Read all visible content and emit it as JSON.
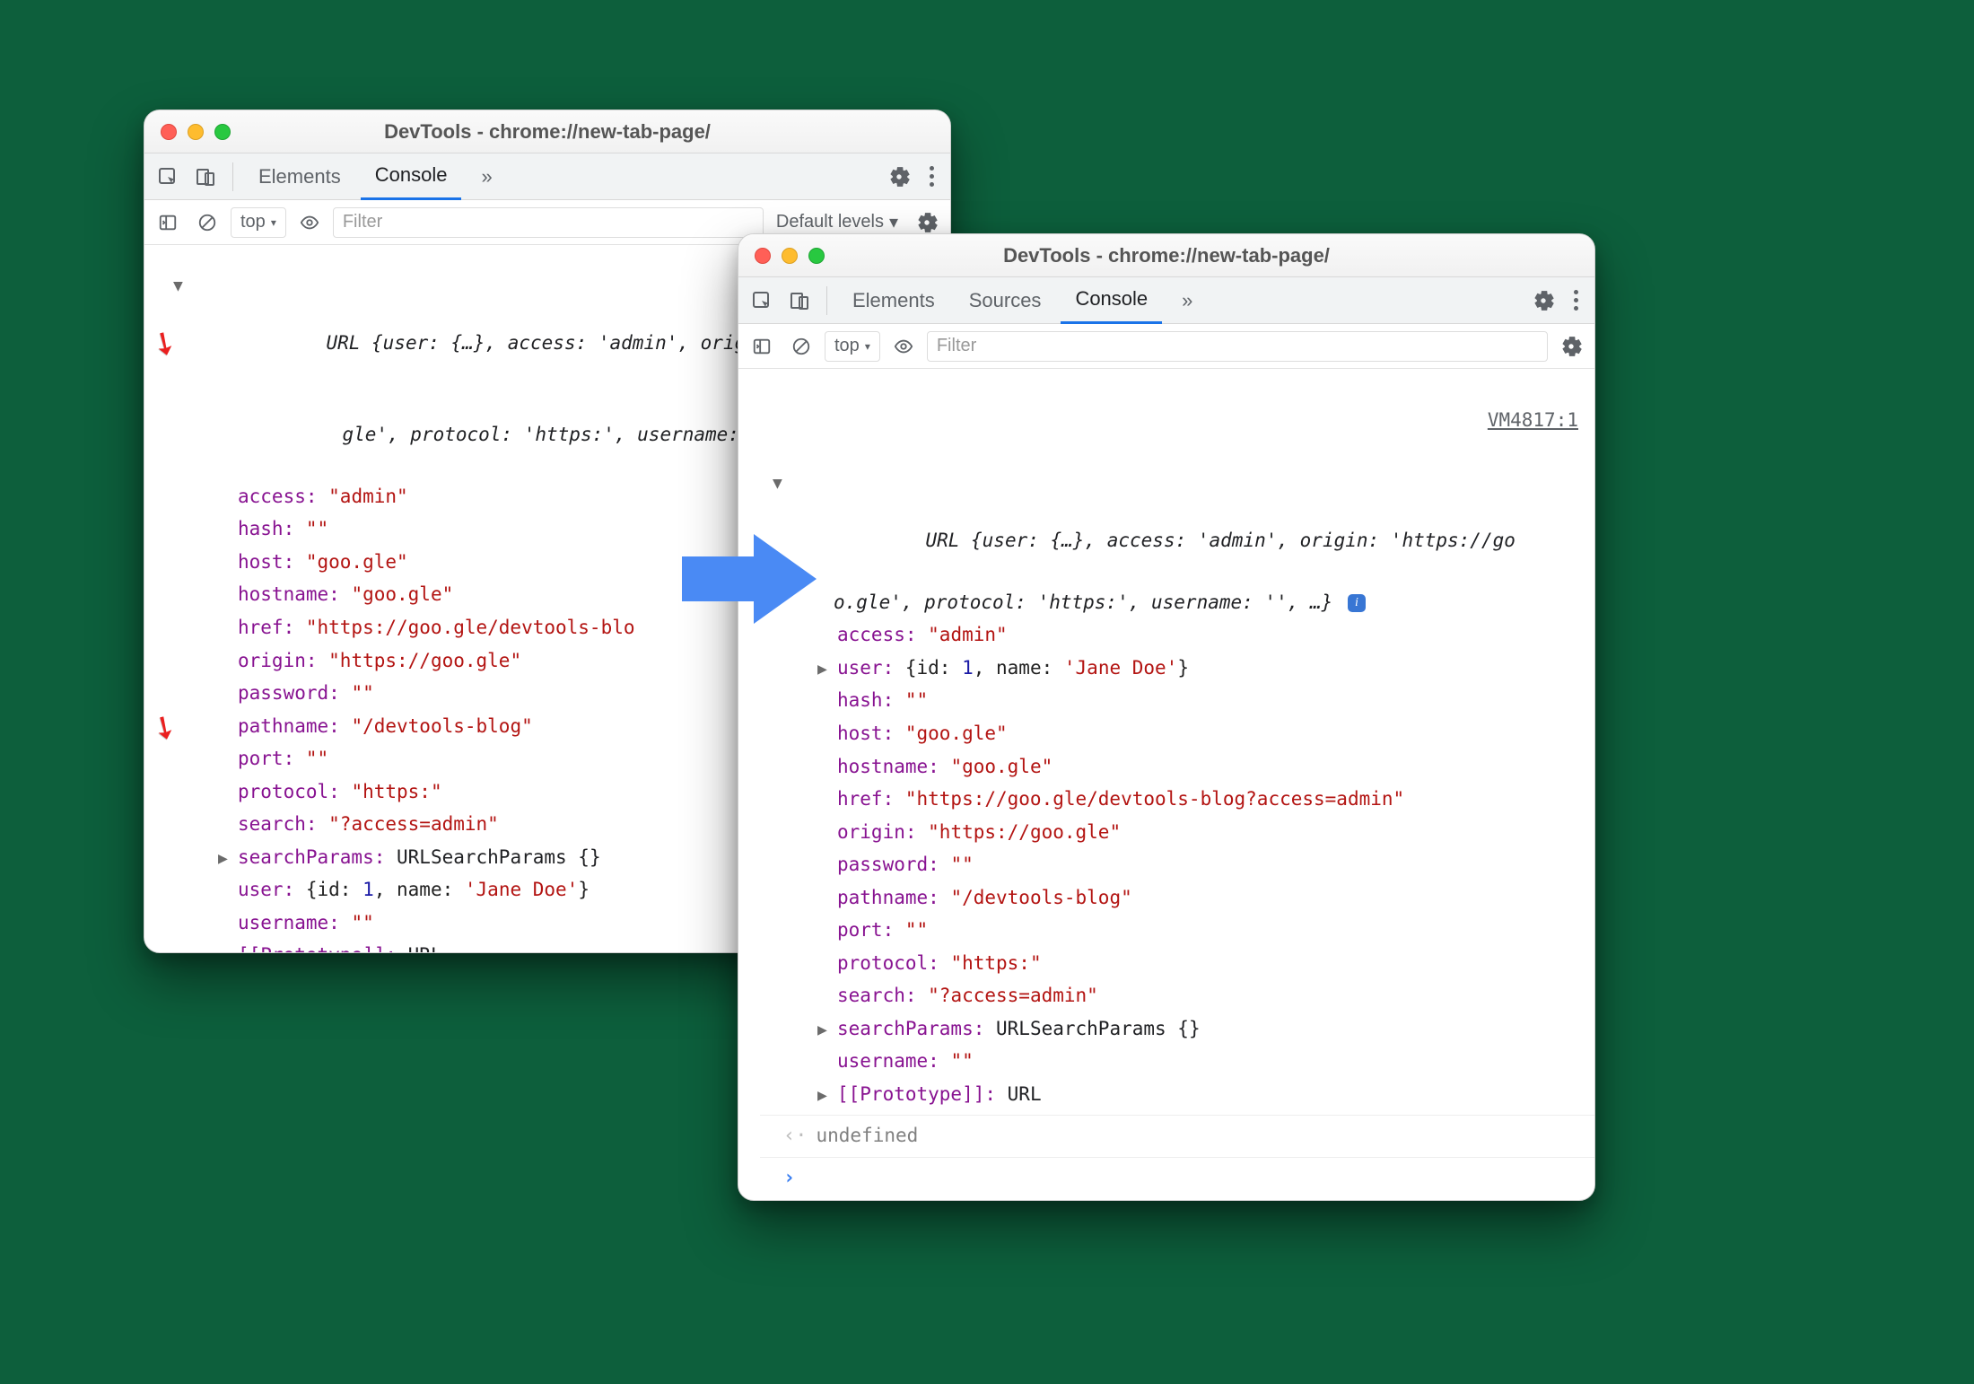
{
  "shared": {
    "title": "DevTools - chrome://new-tab-page/",
    "tab_elements": "Elements",
    "tab_sources": "Sources",
    "tab_console": "Console",
    "more_tabs": "»",
    "filter_placeholder": "Filter",
    "context": "top",
    "triangle": "▾",
    "default_levels": "Default levels",
    "undefined": "undefined",
    "searchParams": "searchParams: ",
    "searchParamsVal": "URLSearchParams {}",
    "prototype": "[[Prototype]]: ",
    "prototypeVal": "URL"
  },
  "left": {
    "summary1": "URL {user: {…}, access: 'admin', orig",
    "summary2": "gle', protocol: 'https:', username: '",
    "p_access_k": "access: ",
    "p_access_v": "\"admin\"",
    "p_hash_k": "hash: ",
    "p_hash_v": "\"\"",
    "p_host_k": "host: ",
    "p_host_v": "\"goo.gle\"",
    "p_hostname_k": "hostname: ",
    "p_hostname_v": "\"goo.gle\"",
    "p_href_k": "href: ",
    "p_href_v": "\"https://goo.gle/devtools-blo",
    "p_origin_k": "origin: ",
    "p_origin_v": "\"https://goo.gle\"",
    "p_password_k": "password: ",
    "p_password_v": "\"\"",
    "p_pathname_k": "pathname: ",
    "p_pathname_v": "\"/devtools-blog\"",
    "p_port_k": "port: ",
    "p_port_v": "\"\"",
    "p_protocol_k": "protocol: ",
    "p_protocol_v": "\"https:\"",
    "p_search_k": "search: ",
    "p_search_v": "\"?access=admin\"",
    "p_user_k": "user: ",
    "p_user_v": "{id: 1, name: 'Jane Doe'}",
    "p_username_k": "username: ",
    "p_username_v": "\"\""
  },
  "right": {
    "source": "VM4817:1",
    "summary1": "URL {user: {…}, access: 'admin', origin: 'https://go",
    "summary2": "o.gle', protocol: 'https:', username: '', …}",
    "p_access_k": "access: ",
    "p_access_v": "\"admin\"",
    "p_user_k": "user: ",
    "p_user_v_pre": "{id: ",
    "p_user_v_num": "1",
    "p_user_v_mid": ", name: ",
    "p_user_v_str": "'Jane Doe'",
    "p_user_v_post": "}",
    "p_hash_k": "hash: ",
    "p_hash_v": "\"\"",
    "p_host_k": "host: ",
    "p_host_v": "\"goo.gle\"",
    "p_hostname_k": "hostname: ",
    "p_hostname_v": "\"goo.gle\"",
    "p_href_k": "href: ",
    "p_href_v": "\"https://goo.gle/devtools-blog?access=admin\"",
    "p_origin_k": "origin: ",
    "p_origin_v": "\"https://goo.gle\"",
    "p_password_k": "password: ",
    "p_password_v": "\"\"",
    "p_pathname_k": "pathname: ",
    "p_pathname_v": "\"/devtools-blog\"",
    "p_port_k": "port: ",
    "p_port_v": "\"\"",
    "p_protocol_k": "protocol: ",
    "p_protocol_v": "\"https:\"",
    "p_search_k": "search: ",
    "p_search_v": "\"?access=admin\"",
    "p_username_k": "username: ",
    "p_username_v": "\"\""
  }
}
